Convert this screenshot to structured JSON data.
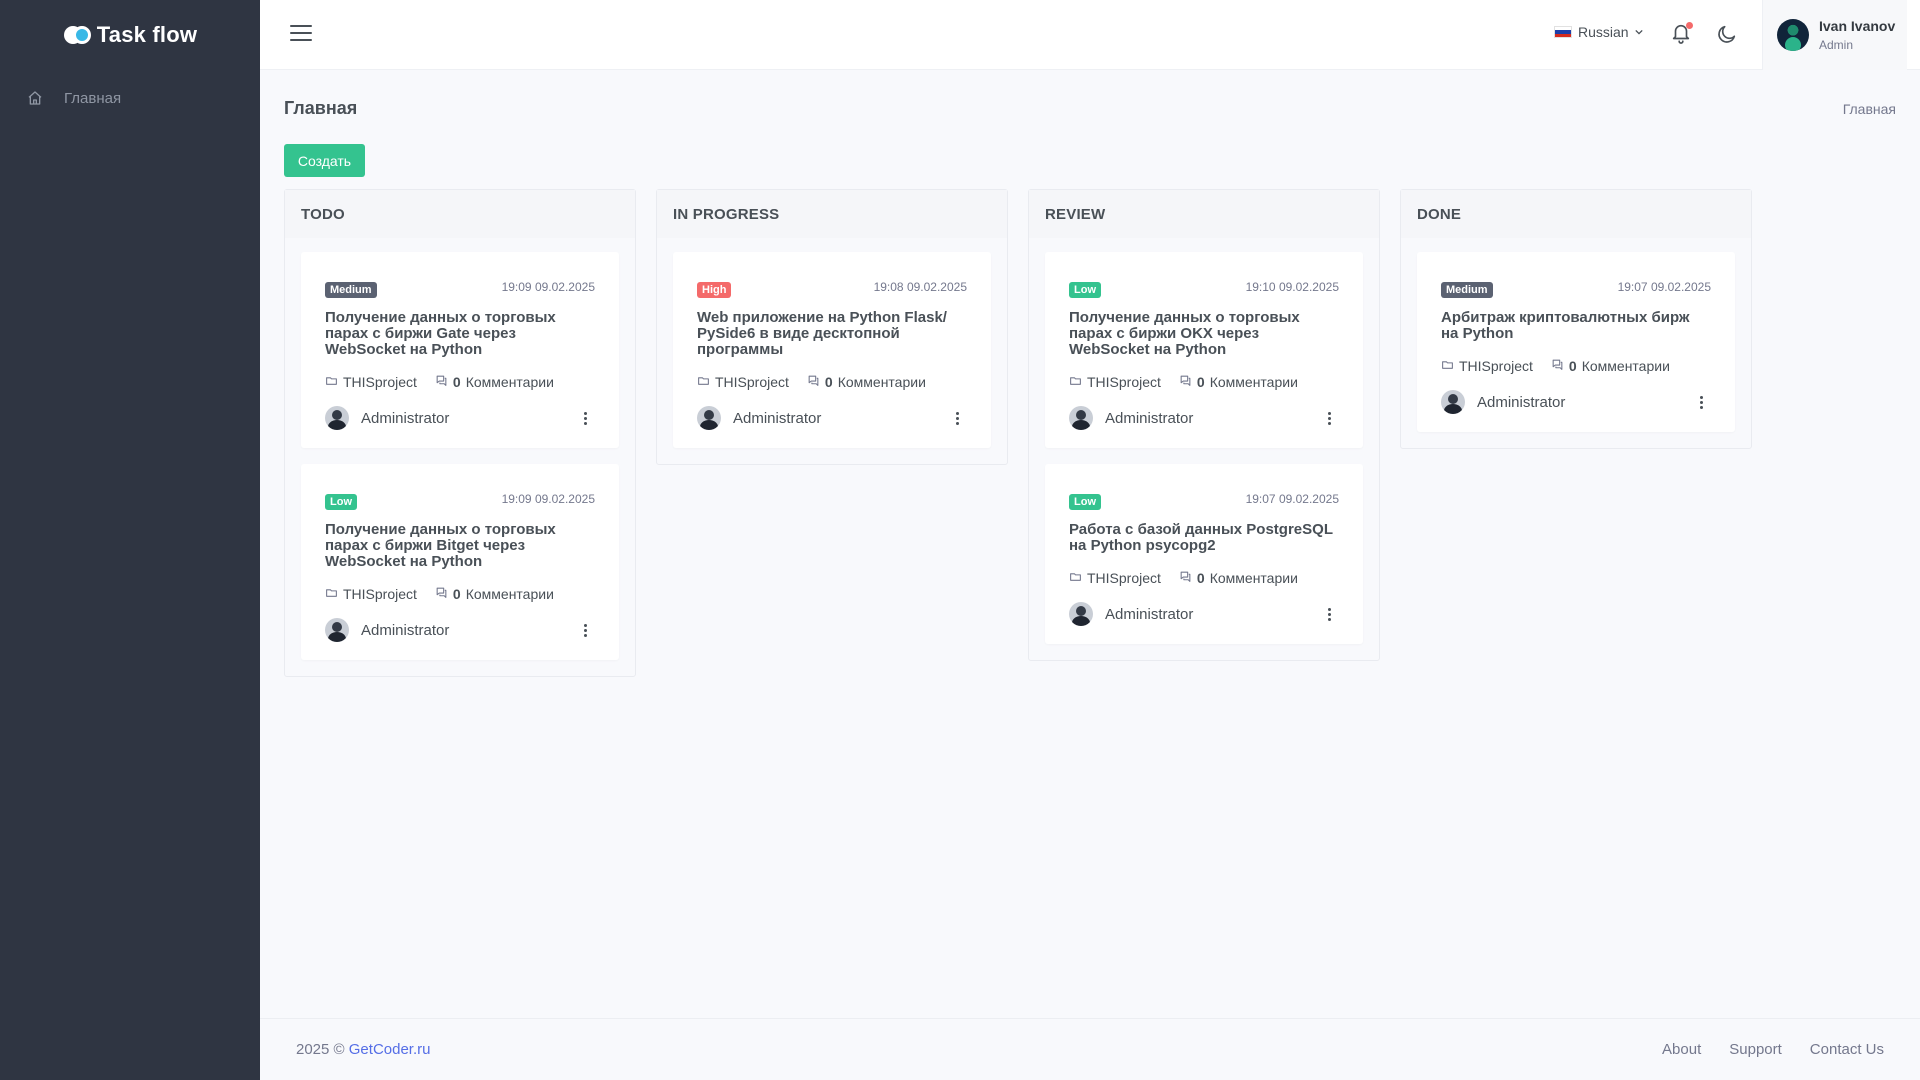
{
  "app": {
    "name": "Task flow"
  },
  "sidebar": {
    "items": [
      {
        "label": "Главная",
        "icon": "home-icon"
      }
    ]
  },
  "header": {
    "language": "Russian",
    "user": {
      "name": "Ivan Ivanov",
      "role": "Admin"
    }
  },
  "page": {
    "title": "Главная",
    "breadcrumb": "Главная",
    "create_label": "Создать"
  },
  "board": {
    "columns": [
      {
        "title": "TODO",
        "cards": [
          {
            "priority": "Medium",
            "time": "19:09 09.02.2025",
            "title": "Получение данных о торговых парах с биржи Gate через WebSocket на Python",
            "project": "THISproject",
            "comments_count": "0",
            "comments_label": "Комментарии",
            "assignee": "Administrator"
          },
          {
            "priority": "Low",
            "time": "19:09 09.02.2025",
            "title": "Получение данных о торговых парах с биржи Bitget через WebSocket на Python",
            "project": "THISproject",
            "comments_count": "0",
            "comments_label": "Комментарии",
            "assignee": "Administrator"
          }
        ]
      },
      {
        "title": "IN PROGRESS",
        "cards": [
          {
            "priority": "High",
            "time": "19:08 09.02.2025",
            "title": "Web приложение на Python Flask/ PySide6 в виде десктопной программы",
            "project": "THISproject",
            "comments_count": "0",
            "comments_label": "Комментарии",
            "assignee": "Administrator"
          }
        ]
      },
      {
        "title": "REVIEW",
        "cards": [
          {
            "priority": "Low",
            "time": "19:10 09.02.2025",
            "title": "Получение данных о торговых парах с биржи OKX через WebSocket на Python",
            "project": "THISproject",
            "comments_count": "0",
            "comments_label": "Комментарии",
            "assignee": "Administrator"
          },
          {
            "priority": "Low",
            "time": "19:07 09.02.2025",
            "title": "Работа с базой данных PostgreSQL на Python psycopg2",
            "project": "THISproject",
            "comments_count": "0",
            "comments_label": "Комментарии",
            "assignee": "Administrator"
          }
        ]
      },
      {
        "title": "DONE",
        "cards": [
          {
            "priority": "Medium",
            "time": "19:07 09.02.2025",
            "title": "Арбитраж криптовалютных бирж на Python",
            "project": "THISproject",
            "comments_count": "0",
            "comments_label": "Комментарии",
            "assignee": "Administrator"
          }
        ]
      }
    ]
  },
  "footer": {
    "copyright": "2025 ©",
    "site": "GetCoder.ru",
    "links": [
      "About",
      "Support",
      "Contact Us"
    ]
  },
  "colors": {
    "accent": "#34c38f",
    "sidebar": "#2f3542",
    "high": "#f46a6a",
    "medium": "#5b6272",
    "link": "#556ee6"
  }
}
